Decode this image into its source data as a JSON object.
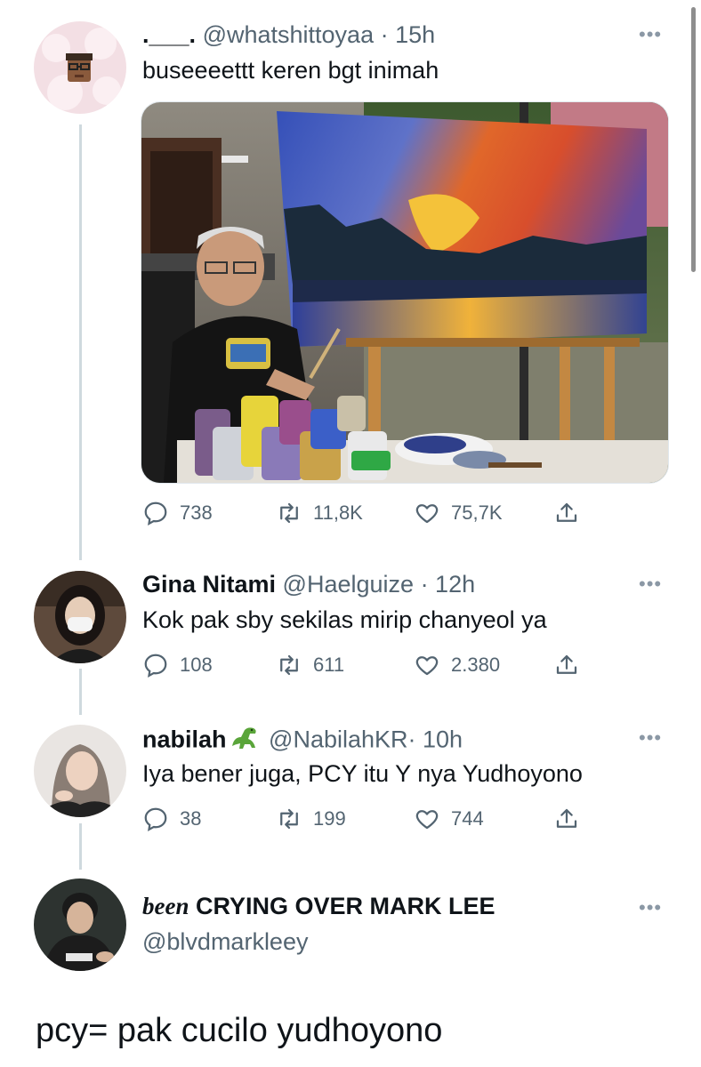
{
  "tweets": [
    {
      "display_name": ".___.",
      "handle": "@whatshittoyaa",
      "time": "· 15h",
      "text": "buseeeettt keren bgt inimah",
      "replies": "738",
      "retweets": "11,8K",
      "likes": "75,7K",
      "has_media": true
    },
    {
      "display_name": "Gina Nitami",
      "handle": "@Haelguize",
      "time": "· 12h",
      "text": "Kok pak sby sekilas mirip chanyeol ya",
      "replies": "108",
      "retweets": "611",
      "likes": "2.380"
    },
    {
      "display_name": "nabilah",
      "handle": "@NabilahKR",
      "time": "· 10h",
      "text": "Iya bener juga, PCY itu Y nya Yudhoyono",
      "replies": "38",
      "retweets": "199",
      "likes": "744"
    },
    {
      "display_name_italic": "been",
      "display_name_rest": "CRYING OVER MARK LEE",
      "handle": "@blvdmarkleey"
    }
  ],
  "more_label": "•••",
  "reply_text": "pcy= pak cucilo yudhoyono",
  "colors": {
    "text": "#0f1419",
    "muted": "#536471",
    "thread_line": "#cfd9de"
  },
  "icons": [
    "reply-icon",
    "retweet-icon",
    "like-icon",
    "share-icon",
    "more-icon",
    "dinosaur-emoji"
  ]
}
